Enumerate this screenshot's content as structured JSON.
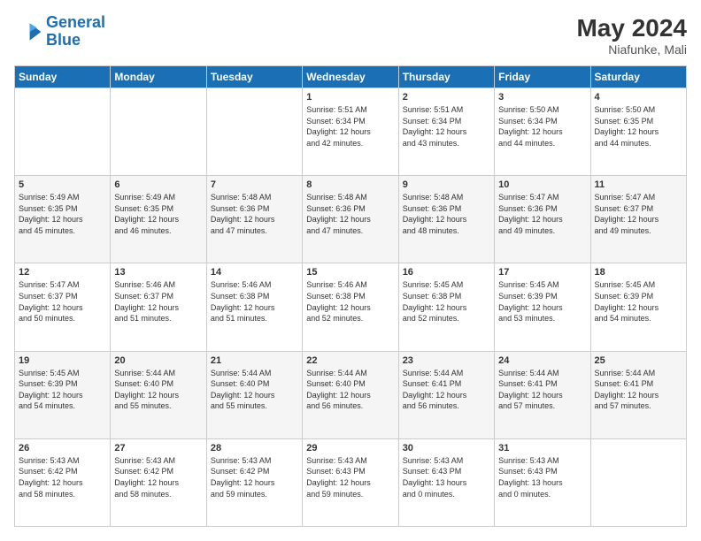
{
  "header": {
    "logo_line1": "General",
    "logo_line2": "Blue",
    "month_year": "May 2024",
    "location": "Niafunke, Mali"
  },
  "days_of_week": [
    "Sunday",
    "Monday",
    "Tuesday",
    "Wednesday",
    "Thursday",
    "Friday",
    "Saturday"
  ],
  "weeks": [
    [
      {
        "day": "",
        "info": ""
      },
      {
        "day": "",
        "info": ""
      },
      {
        "day": "",
        "info": ""
      },
      {
        "day": "1",
        "info": "Sunrise: 5:51 AM\nSunset: 6:34 PM\nDaylight: 12 hours\nand 42 minutes."
      },
      {
        "day": "2",
        "info": "Sunrise: 5:51 AM\nSunset: 6:34 PM\nDaylight: 12 hours\nand 43 minutes."
      },
      {
        "day": "3",
        "info": "Sunrise: 5:50 AM\nSunset: 6:34 PM\nDaylight: 12 hours\nand 44 minutes."
      },
      {
        "day": "4",
        "info": "Sunrise: 5:50 AM\nSunset: 6:35 PM\nDaylight: 12 hours\nand 44 minutes."
      }
    ],
    [
      {
        "day": "5",
        "info": "Sunrise: 5:49 AM\nSunset: 6:35 PM\nDaylight: 12 hours\nand 45 minutes."
      },
      {
        "day": "6",
        "info": "Sunrise: 5:49 AM\nSunset: 6:35 PM\nDaylight: 12 hours\nand 46 minutes."
      },
      {
        "day": "7",
        "info": "Sunrise: 5:48 AM\nSunset: 6:36 PM\nDaylight: 12 hours\nand 47 minutes."
      },
      {
        "day": "8",
        "info": "Sunrise: 5:48 AM\nSunset: 6:36 PM\nDaylight: 12 hours\nand 47 minutes."
      },
      {
        "day": "9",
        "info": "Sunrise: 5:48 AM\nSunset: 6:36 PM\nDaylight: 12 hours\nand 48 minutes."
      },
      {
        "day": "10",
        "info": "Sunrise: 5:47 AM\nSunset: 6:36 PM\nDaylight: 12 hours\nand 49 minutes."
      },
      {
        "day": "11",
        "info": "Sunrise: 5:47 AM\nSunset: 6:37 PM\nDaylight: 12 hours\nand 49 minutes."
      }
    ],
    [
      {
        "day": "12",
        "info": "Sunrise: 5:47 AM\nSunset: 6:37 PM\nDaylight: 12 hours\nand 50 minutes."
      },
      {
        "day": "13",
        "info": "Sunrise: 5:46 AM\nSunset: 6:37 PM\nDaylight: 12 hours\nand 51 minutes."
      },
      {
        "day": "14",
        "info": "Sunrise: 5:46 AM\nSunset: 6:38 PM\nDaylight: 12 hours\nand 51 minutes."
      },
      {
        "day": "15",
        "info": "Sunrise: 5:46 AM\nSunset: 6:38 PM\nDaylight: 12 hours\nand 52 minutes."
      },
      {
        "day": "16",
        "info": "Sunrise: 5:45 AM\nSunset: 6:38 PM\nDaylight: 12 hours\nand 52 minutes."
      },
      {
        "day": "17",
        "info": "Sunrise: 5:45 AM\nSunset: 6:39 PM\nDaylight: 12 hours\nand 53 minutes."
      },
      {
        "day": "18",
        "info": "Sunrise: 5:45 AM\nSunset: 6:39 PM\nDaylight: 12 hours\nand 54 minutes."
      }
    ],
    [
      {
        "day": "19",
        "info": "Sunrise: 5:45 AM\nSunset: 6:39 PM\nDaylight: 12 hours\nand 54 minutes."
      },
      {
        "day": "20",
        "info": "Sunrise: 5:44 AM\nSunset: 6:40 PM\nDaylight: 12 hours\nand 55 minutes."
      },
      {
        "day": "21",
        "info": "Sunrise: 5:44 AM\nSunset: 6:40 PM\nDaylight: 12 hours\nand 55 minutes."
      },
      {
        "day": "22",
        "info": "Sunrise: 5:44 AM\nSunset: 6:40 PM\nDaylight: 12 hours\nand 56 minutes."
      },
      {
        "day": "23",
        "info": "Sunrise: 5:44 AM\nSunset: 6:41 PM\nDaylight: 12 hours\nand 56 minutes."
      },
      {
        "day": "24",
        "info": "Sunrise: 5:44 AM\nSunset: 6:41 PM\nDaylight: 12 hours\nand 57 minutes."
      },
      {
        "day": "25",
        "info": "Sunrise: 5:44 AM\nSunset: 6:41 PM\nDaylight: 12 hours\nand 57 minutes."
      }
    ],
    [
      {
        "day": "26",
        "info": "Sunrise: 5:43 AM\nSunset: 6:42 PM\nDaylight: 12 hours\nand 58 minutes."
      },
      {
        "day": "27",
        "info": "Sunrise: 5:43 AM\nSunset: 6:42 PM\nDaylight: 12 hours\nand 58 minutes."
      },
      {
        "day": "28",
        "info": "Sunrise: 5:43 AM\nSunset: 6:42 PM\nDaylight: 12 hours\nand 59 minutes."
      },
      {
        "day": "29",
        "info": "Sunrise: 5:43 AM\nSunset: 6:43 PM\nDaylight: 12 hours\nand 59 minutes."
      },
      {
        "day": "30",
        "info": "Sunrise: 5:43 AM\nSunset: 6:43 PM\nDaylight: 13 hours\nand 0 minutes."
      },
      {
        "day": "31",
        "info": "Sunrise: 5:43 AM\nSunset: 6:43 PM\nDaylight: 13 hours\nand 0 minutes."
      },
      {
        "day": "",
        "info": ""
      }
    ]
  ]
}
